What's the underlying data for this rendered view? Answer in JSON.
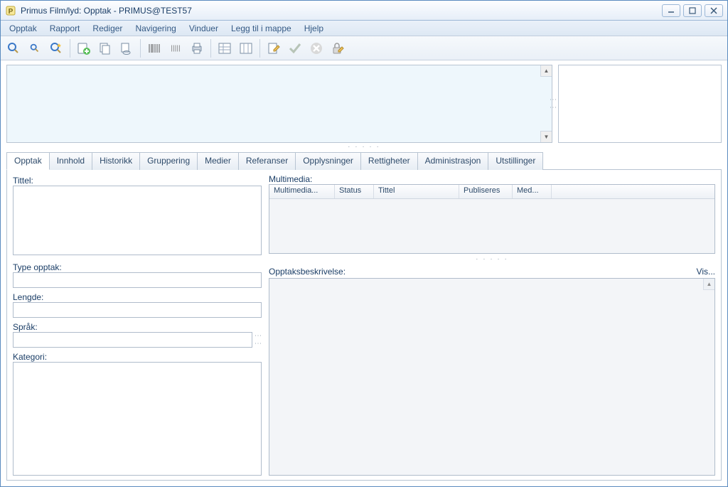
{
  "window": {
    "title": "Primus Film/lyd: Opptak - PRIMUS@TEST57"
  },
  "menu": {
    "items": [
      "Opptak",
      "Rapport",
      "Rediger",
      "Navigering",
      "Vinduer",
      "Legg til i mappe",
      "Hjelp"
    ]
  },
  "tabs": {
    "items": [
      "Opptak",
      "Innhold",
      "Historikk",
      "Gruppering",
      "Medier",
      "Referanser",
      "Opplysninger",
      "Rettigheter",
      "Administrasjon",
      "Utstillinger"
    ],
    "active_index": 0
  },
  "labels": {
    "tittel": "Tittel:",
    "type_opptak": "Type opptak:",
    "lengde": "Lengde:",
    "sprak": "Språk:",
    "kategori": "Kategori:",
    "multimedia": "Multimedia:",
    "opptaksbeskrivelse": "Opptaksbeskrivelse:",
    "vis": "Vis..."
  },
  "multimedia_table": {
    "columns": [
      "Multimedia...",
      "Status",
      "Tittel",
      "Publiseres",
      "Med..."
    ]
  },
  "fields": {
    "tittel": "",
    "type_opptak": "",
    "lengde": "",
    "sprak": "",
    "kategori": "",
    "opptaksbeskrivelse": ""
  }
}
